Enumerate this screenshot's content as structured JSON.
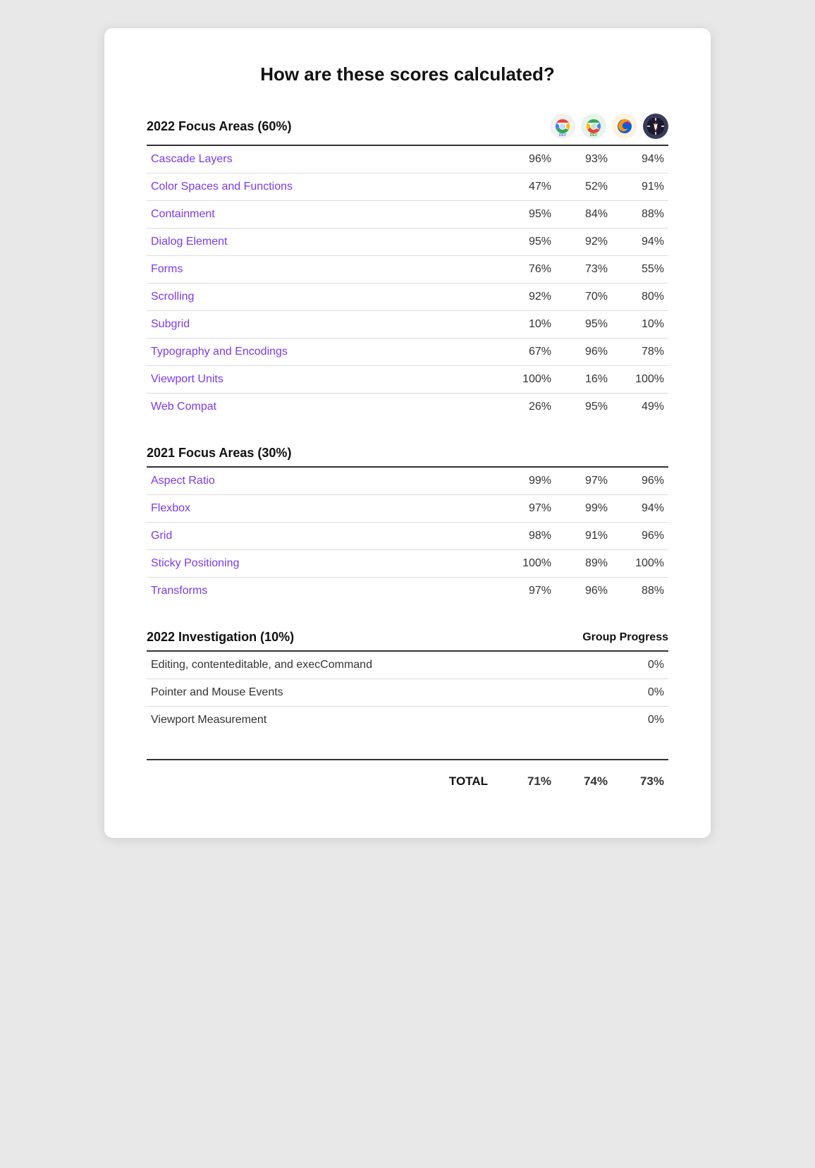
{
  "title": "How are these scores calculated?",
  "section2022": {
    "label": "2022 Focus Areas (60%)",
    "browsers": [
      "chrome-dev",
      "firefox",
      "safari"
    ],
    "rows": [
      {
        "name": "Cascade Layers",
        "scores": [
          "96%",
          "93%",
          "94%"
        ]
      },
      {
        "name": "Color Spaces and Functions",
        "scores": [
          "47%",
          "52%",
          "91%"
        ]
      },
      {
        "name": "Containment",
        "scores": [
          "95%",
          "84%",
          "88%"
        ]
      },
      {
        "name": "Dialog Element",
        "scores": [
          "95%",
          "92%",
          "94%"
        ]
      },
      {
        "name": "Forms",
        "scores": [
          "76%",
          "73%",
          "55%"
        ]
      },
      {
        "name": "Scrolling",
        "scores": [
          "92%",
          "70%",
          "80%"
        ]
      },
      {
        "name": "Subgrid",
        "scores": [
          "10%",
          "95%",
          "10%"
        ]
      },
      {
        "name": "Typography and Encodings",
        "scores": [
          "67%",
          "96%",
          "78%"
        ]
      },
      {
        "name": "Viewport Units",
        "scores": [
          "100%",
          "16%",
          "100%"
        ]
      },
      {
        "name": "Web Compat",
        "scores": [
          "26%",
          "95%",
          "49%"
        ]
      }
    ]
  },
  "section2021": {
    "label": "2021 Focus Areas (30%)",
    "rows": [
      {
        "name": "Aspect Ratio",
        "scores": [
          "99%",
          "97%",
          "96%"
        ]
      },
      {
        "name": "Flexbox",
        "scores": [
          "97%",
          "99%",
          "94%"
        ]
      },
      {
        "name": "Grid",
        "scores": [
          "98%",
          "91%",
          "96%"
        ]
      },
      {
        "name": "Sticky Positioning",
        "scores": [
          "100%",
          "89%",
          "100%"
        ]
      },
      {
        "name": "Transforms",
        "scores": [
          "97%",
          "96%",
          "88%"
        ]
      }
    ]
  },
  "sectionInvestigation": {
    "label": "2022 Investigation (10%)",
    "groupProgressLabel": "Group Progress",
    "rows": [
      {
        "name": "Editing, contenteditable, and execCommand",
        "score": "0%"
      },
      {
        "name": "Pointer and Mouse Events",
        "score": "0%"
      },
      {
        "name": "Viewport Measurement",
        "score": "0%"
      }
    ]
  },
  "total": {
    "label": "TOTAL",
    "scores": [
      "71%",
      "74%",
      "73%"
    ]
  }
}
